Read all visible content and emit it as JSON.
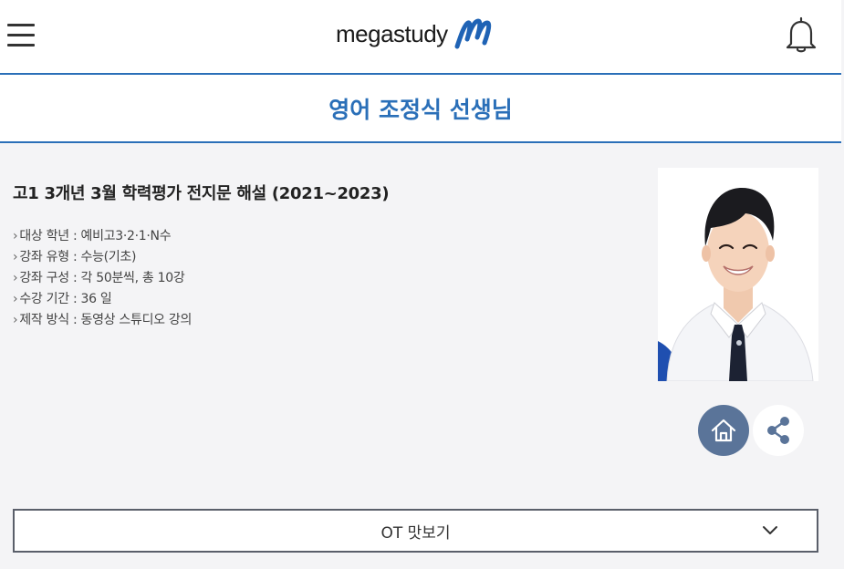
{
  "header": {
    "logo_text": "megastudy",
    "menu_icon": "hamburger-menu-icon",
    "notification_icon": "bell-icon"
  },
  "page_title": "영어 조정식 선생님",
  "course": {
    "title": "고1 3개년 3월 학력평가 전지문 해설 (2021~2023)",
    "details": [
      {
        "label": "대상 학년",
        "value": "예비고3·2·1·N수"
      },
      {
        "label": "강좌 유형",
        "value": "수능(기초)"
      },
      {
        "label": "강좌 구성",
        "value": "각 50분씩, 총 10강"
      },
      {
        "label": "수강 기간",
        "value": "36 일"
      },
      {
        "label": "제작 방식",
        "value": "동영상 스튜디오 강의"
      }
    ]
  },
  "actions": {
    "home_icon": "home-icon",
    "share_icon": "share-icon"
  },
  "ot_select": {
    "label": "OT 맛보기"
  },
  "colors": {
    "accent": "#2a6fb8",
    "home_button": "#5a7499",
    "background": "#f4f4f6"
  }
}
